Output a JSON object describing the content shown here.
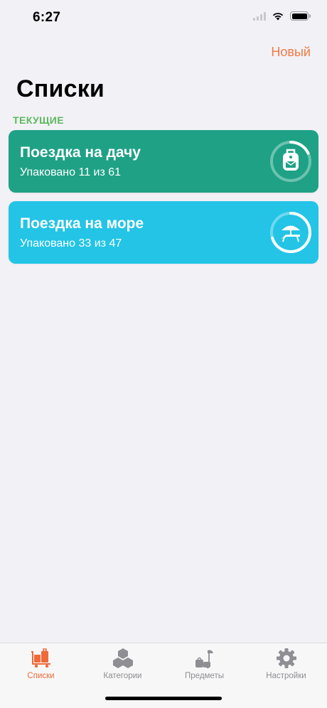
{
  "status": {
    "time": "6:27"
  },
  "header": {
    "new_label": "Новый",
    "title": "Списки"
  },
  "section": {
    "current_label": "ТЕКУЩИЕ"
  },
  "lists": [
    {
      "title": "Поездка на дачу",
      "subtitle": "Упаковано 11 из 61",
      "packed": 11,
      "total": 61,
      "color": "#1fa186",
      "icon": "backpack-icon"
    },
    {
      "title": "Поездка на море",
      "subtitle": "Упаковано 33 из 47",
      "packed": 33,
      "total": 47,
      "color": "#23c4e6",
      "icon": "beach-icon"
    }
  ],
  "tabs": [
    {
      "label": "Списки",
      "icon": "luggage-cart-icon",
      "active": true
    },
    {
      "label": "Категории",
      "icon": "hexagons-icon",
      "active": false
    },
    {
      "label": "Предметы",
      "icon": "umbrella-bags-icon",
      "active": false
    },
    {
      "label": "Настройки",
      "icon": "gear-icon",
      "active": false
    }
  ],
  "colors": {
    "accent": "#ef7a45",
    "section": "#5cb85c",
    "tab_inactive": "#8e8e93"
  }
}
